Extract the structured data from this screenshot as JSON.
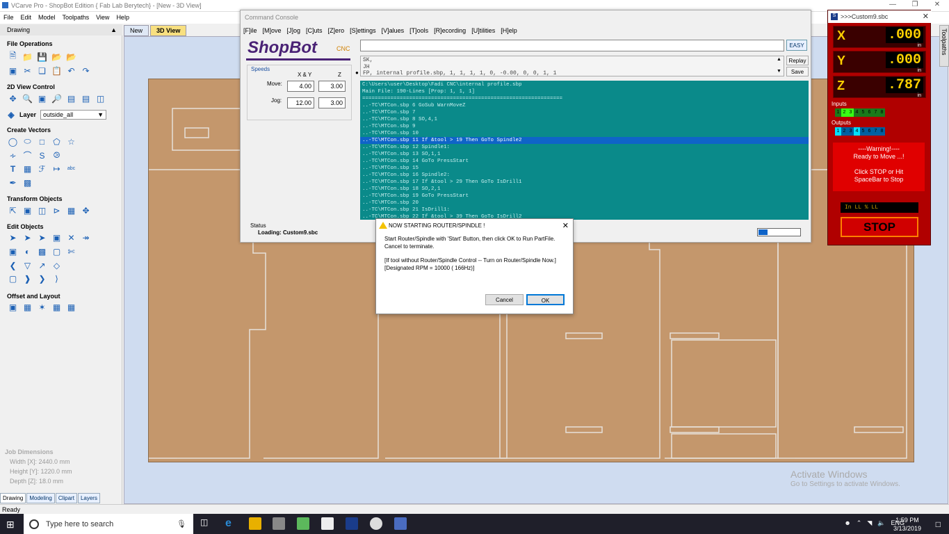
{
  "window": {
    "title": "VCarve Pro - ShopBot Edition { Fab Lab Berytech} - [New - 3D View]"
  },
  "menu": [
    "File",
    "Edit",
    "Model",
    "Toolpaths",
    "View",
    "Help"
  ],
  "left_panel": {
    "header": "Drawing",
    "sections": {
      "file_operations": "File Operations",
      "view_control": "2D View Control",
      "layer_label": "Layer",
      "layer_value": "outside_all",
      "create_vectors": "Create Vectors",
      "transform_objects": "Transform Objects",
      "edit_objects": "Edit Objects",
      "offset_layout": "Offset and Layout"
    },
    "job_dimensions": {
      "title": "Job Dimensions",
      "width": "Width  [X]: 2440.0 mm",
      "height": "Height [Y]: 1220.0 mm",
      "depth": "Depth  [Z]: 18.0 mm"
    },
    "bottom_tabs": [
      "Drawing",
      "Modeling",
      "Clipart",
      "Layers"
    ]
  },
  "doc_tabs": [
    "New",
    "3D View"
  ],
  "right_tab": "Toolpaths",
  "console": {
    "title": "Command Console",
    "menu": [
      "[F]ile",
      "[M]ove",
      "[J]og",
      "[C]uts",
      "[Z]ero",
      "[S]ettings",
      "[V]alues",
      "[T]ools",
      "[R]ecording",
      "[U]tilities",
      "[H]elp"
    ],
    "logo": "ShopBot",
    "logo_suffix": "CNC",
    "speeds_label": "Speeds",
    "xy_label": "X & Y",
    "z_label": "Z",
    "move_label": "Move:",
    "jog_label": "Jog:",
    "move_xy": "4.00",
    "move_z": "3.00",
    "jog_xy": "12.00",
    "jog_z": "3.00",
    "easy": "EASY",
    "replay": "Replay",
    "save": "Save",
    "history": [
      "SK,",
      "JH",
      "FP, internal profile.sbp,  1,  1,  1,  1,  0, -0.00, 0, 0,  1,  1"
    ],
    "file_path": "C:\\Users\\user\\Desktop\\Fadi CNC\\internal profile.sbp",
    "main_file": "Main File:  190-Lines [Prop: 1, 1, 1]",
    "separator": "================================================================",
    "lines": [
      "..-TC\\MTCon.sbp   6 GoSub WarnMoveZ",
      "..-TC\\MTCon.sbp   7",
      "..-TC\\MTCon.sbp   8 SO,4,1",
      "..-TC\\MTCon.sbp   9",
      "..-TC\\MTCon.sbp   10",
      "..-TC\\MTCon.sbp   11 If &tool > 19 Then GoTo Spindle2",
      "..-TC\\MTCon.sbp   12 Spindle1:",
      "..-TC\\MTCon.sbp   13    SO,1,1",
      "..-TC\\MTCon.sbp   14 GoTo PressStart",
      "..-TC\\MTCon.sbp   15",
      "..-TC\\MTCon.sbp   16 Spindle2:",
      "..-TC\\MTCon.sbp   17 If &tool > 29 Then GoTo IsDrill1",
      "..-TC\\MTCon.sbp   18    SO,2,1",
      "..-TC\\MTCon.sbp   19 GoTo PressStart",
      "..-TC\\MTCon.sbp   20",
      "..-TC\\MTCon.sbp   21 IsDrill1:",
      "..-TC\\MTCon.sbp   22 If &tool > 39 Then GoTo IsDrill2"
    ],
    "highlight_index": 5,
    "status_label": "Status",
    "status_value": "Loading: Custom9.sbc",
    "progress": 0.22
  },
  "dialog": {
    "title": "NOW STARTING ROUTER/SPINDLE !",
    "message1": "Start Router/Spindle with 'Start' Button, then click OK to Run PartFile. Cancel to terminate.",
    "message2": "[If tool without Router/Spindle Control -- Turn on Router/Spindle Now.]  [Designated RPM = 10000 ( 166Hz)]",
    "cancel": "Cancel",
    "ok": "OK"
  },
  "dro": {
    "title": ">>>Custom9.sbc",
    "x_label": "X",
    "x_value": ".000",
    "y_label": "Y",
    "y_value": ".000",
    "z_label": "Z",
    "z_value": ".787",
    "unit": "in",
    "inputs_label": "Inputs",
    "outputs_label": "Outputs",
    "io_digits": [
      "1",
      "2",
      "3",
      "4",
      "5",
      "6",
      "7",
      "8"
    ],
    "warning_title": "----Warning!----",
    "warning_line2": "Ready to Move ...!",
    "warning_line3": "Click STOP or Hit",
    "warning_line4": "SpaceBar to Stop",
    "info": "In     LL    % LL",
    "stop": "STOP"
  },
  "watermark": {
    "line1": "Activate Windows",
    "line2": "Go to Settings to activate Windows."
  },
  "statusbar": "Ready",
  "taskbar": {
    "search_placeholder": "Type here to search",
    "lang": "ENG",
    "time": "1:59 PM",
    "date": "3/13/2019"
  }
}
